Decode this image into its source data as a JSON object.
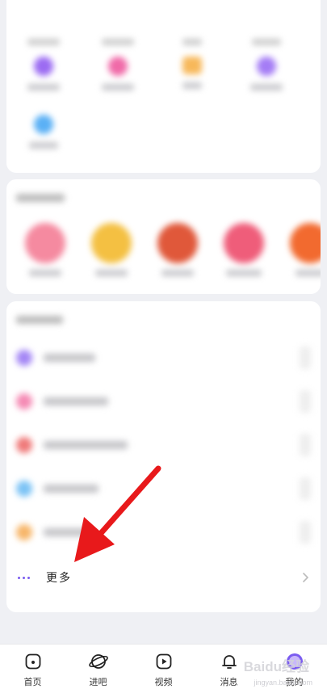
{
  "top_bar": {
    "icons": [
      "scan-icon",
      "wardrobe-icon",
      "settings-gear-icon"
    ]
  },
  "menu": {
    "more_label": "更多"
  },
  "bottom_nav": {
    "items": [
      {
        "label": "首页",
        "icon": "home-icon"
      },
      {
        "label": "进吧",
        "icon": "planet-icon"
      },
      {
        "label": "视频",
        "icon": "video-play-icon"
      },
      {
        "label": "消息",
        "icon": "bell-icon"
      },
      {
        "label": "我的",
        "icon": "avatar-icon"
      }
    ]
  },
  "watermark": {
    "text": "Baidu经验",
    "sub": "jingyan.baidu.com"
  },
  "colors": {
    "accent": "#7b5cf0",
    "arrow": "#e8191b",
    "background": "#eff0f4"
  }
}
